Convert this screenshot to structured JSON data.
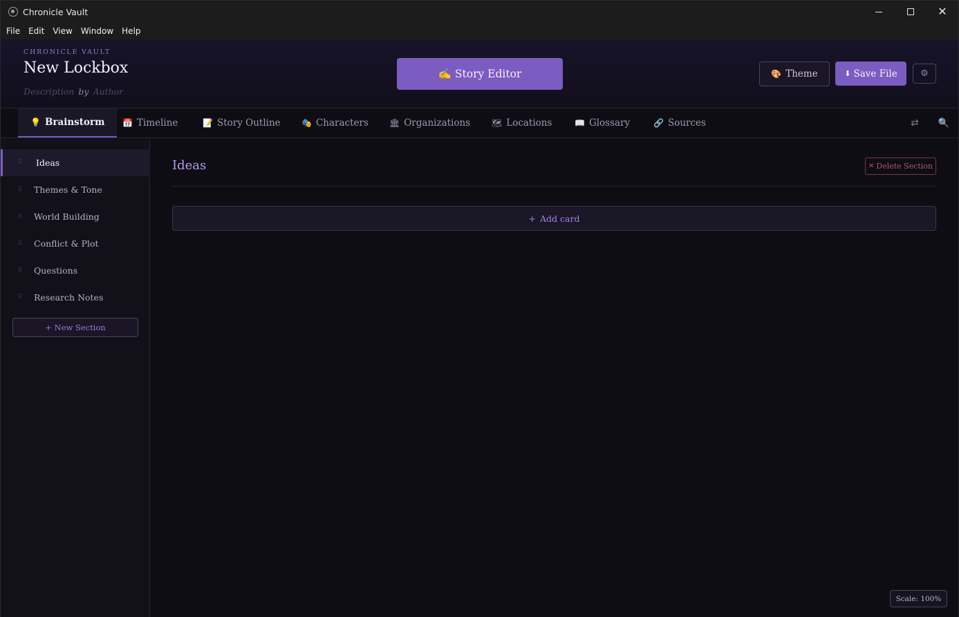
{
  "window": {
    "title": "Chronicle Vault",
    "controls": {
      "minimize": "",
      "maximize": "",
      "close": "✕"
    }
  },
  "menubar": [
    "File",
    "Edit",
    "View",
    "Window",
    "Help"
  ],
  "header": {
    "brand": "CHRONICLE VAULT",
    "title": "New Lockbox",
    "description_placeholder": "Description",
    "by": "by",
    "author_placeholder": "Author",
    "story_editor": {
      "icon": "✍",
      "label": "Story Editor"
    },
    "theme": {
      "icon": "🎨",
      "label": "Theme"
    },
    "save": {
      "icon": "⬇",
      "label": "Save File"
    },
    "settings_icon": "⚙"
  },
  "tabs": [
    {
      "icon": "💡",
      "label": "Brainstorm",
      "active": true
    },
    {
      "icon": "📅",
      "label": "Timeline"
    },
    {
      "icon": "📝",
      "label": "Story Outline"
    },
    {
      "icon": "🎭",
      "label": "Characters"
    },
    {
      "icon": "🏛",
      "label": "Organizations"
    },
    {
      "icon": "🗺",
      "label": "Locations"
    },
    {
      "icon": "📖",
      "label": "Glossary"
    },
    {
      "icon": "🔗",
      "label": "Sources"
    }
  ],
  "tab_tools": {
    "swap_icon": "⇄",
    "search_icon": "🔍"
  },
  "sidebar": {
    "grip_glyph": "⠿",
    "items": [
      {
        "label": "Ideas",
        "active": true
      },
      {
        "label": "Themes & Tone"
      },
      {
        "label": "World Building"
      },
      {
        "label": "Conflict & Plot"
      },
      {
        "label": "Questions"
      },
      {
        "label": "Research Notes"
      }
    ],
    "new_section": "+ New Section"
  },
  "main": {
    "section_title": "Ideas",
    "delete_section": {
      "icon": "✕",
      "label": "Delete Section"
    },
    "add_card": {
      "icon": "+",
      "label": "Add card"
    },
    "scale": "Scale: 100%"
  },
  "colors": {
    "accent": "#7b5cc0",
    "accent_text": "#b49cf0",
    "background": "#0e0d13",
    "danger": "#b0566a"
  }
}
